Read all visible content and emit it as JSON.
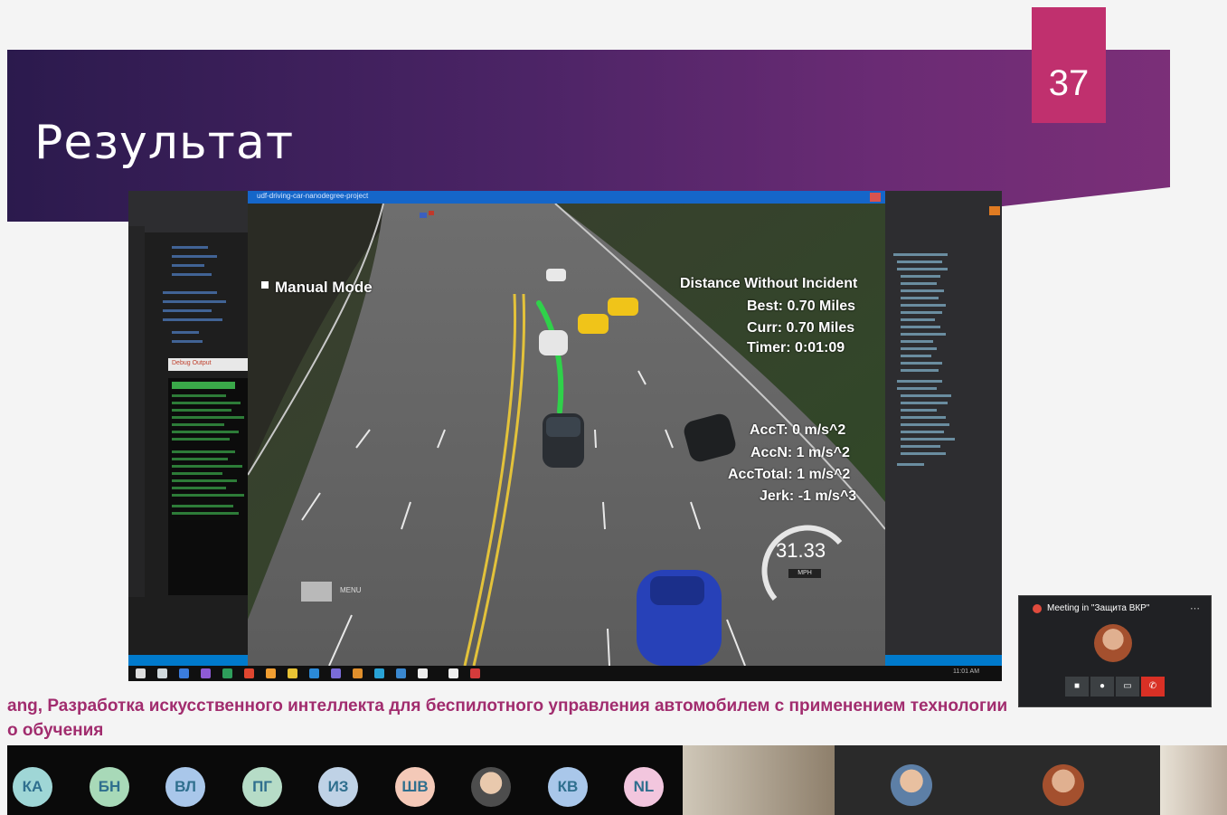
{
  "slide": {
    "title": "Результат",
    "page_number": "37",
    "caption_line1": "ang, Разработка искусственного интеллекта для беспилотного управления автомобилем с применением технологии",
    "caption_line2": "о обучения"
  },
  "vs": {
    "window_title": "udf-driving-car-nanodegree-project",
    "output_tab": "Debug Output",
    "time": "11:01 AM"
  },
  "sim": {
    "mode": "Manual Mode",
    "distance_title": "Distance Without Incident",
    "best": "Best: 0.70 Miles",
    "curr": "Curr: 0.70 Miles",
    "timer": "Timer: 0:01:09",
    "acc_t": "AccT: 0 m/s^2",
    "acc_n": "AccN: 1 m/s^2",
    "acc_total": "AccTotal: 1 m/s^2",
    "jerk": "Jerk: -1 m/s^3",
    "speed": "31.33",
    "speed_unit": "MPH",
    "menu_label": "MENU"
  },
  "meeting": {
    "title": "Meeting in \"Защита ВКР\"",
    "menu": "⋯"
  },
  "participants": [
    "КА",
    "БН",
    "ВЛ",
    "ПГ",
    "ИЗ",
    "ШВ",
    "КВ",
    "NL"
  ],
  "colors": {
    "accent_pink": "#c0306e",
    "caption": "#a12c6e",
    "participant_text": "#2f6f8e"
  }
}
